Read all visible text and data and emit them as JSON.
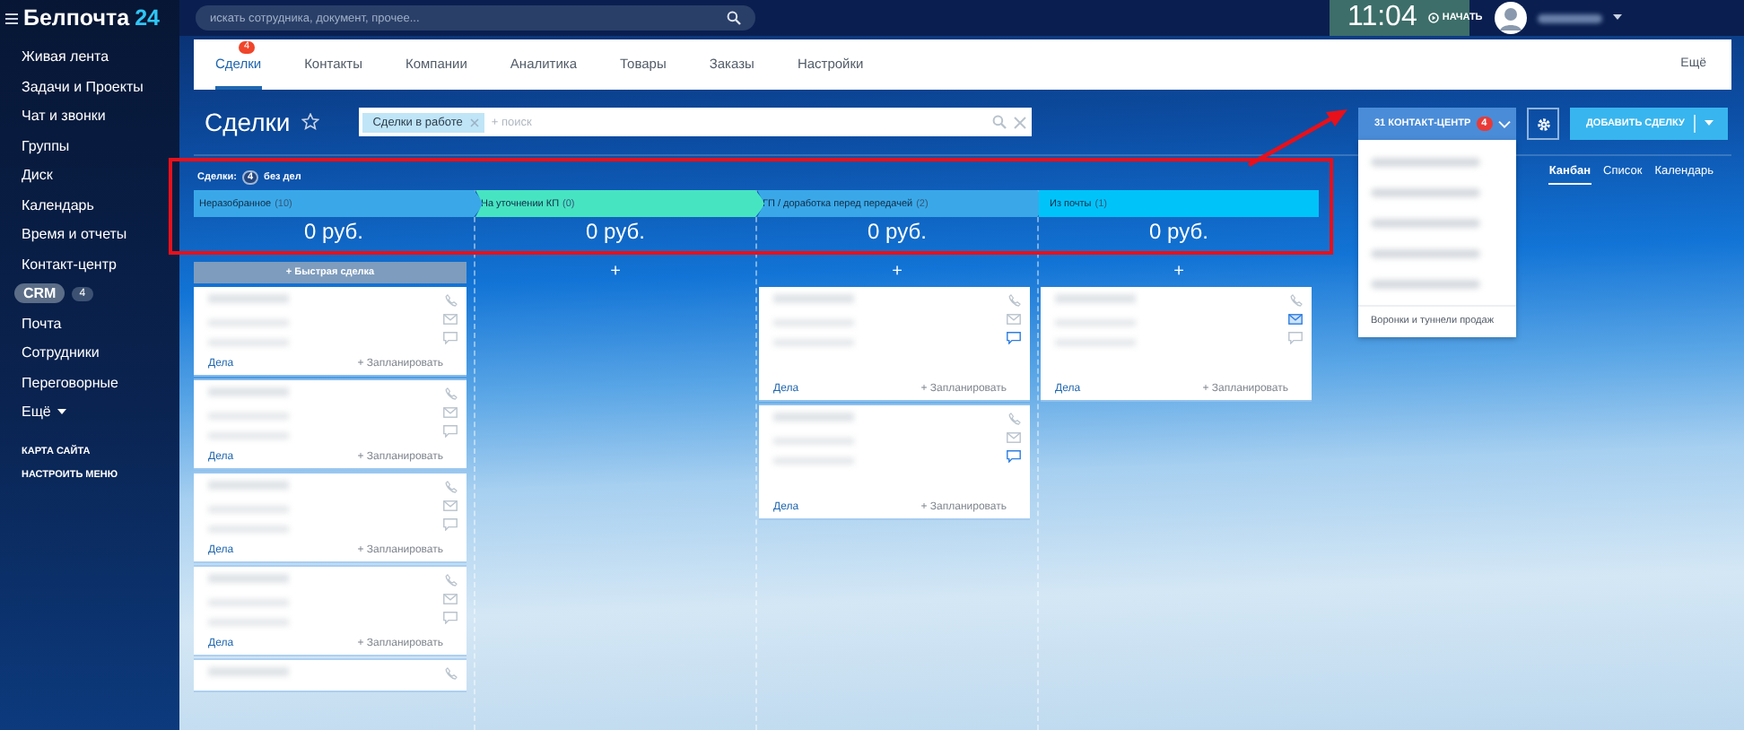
{
  "sidebar": {
    "logo": {
      "name": "Белпочта",
      "number": "24"
    },
    "items": [
      {
        "label": "Живая лента",
        "selected": false
      },
      {
        "label": "Задачи и Проекты",
        "selected": false
      },
      {
        "label": "Чат и звонки",
        "selected": false
      },
      {
        "label": "Группы",
        "selected": false
      },
      {
        "label": "Диск",
        "selected": false
      },
      {
        "label": "Календарь",
        "selected": false
      },
      {
        "label": "Время и отчеты",
        "selected": false
      },
      {
        "label": "Контакт-центр",
        "selected": false
      },
      {
        "label": "CRM",
        "selected": true,
        "badge": "4"
      },
      {
        "label": "Почта",
        "selected": false
      },
      {
        "label": "Сотрудники",
        "selected": false
      },
      {
        "label": "Переговорные",
        "selected": false
      },
      {
        "label": "Ещё",
        "selected": false,
        "caret": true
      }
    ],
    "footer_links": [
      "КАРТА САЙТА",
      "НАСТРОИТЬ МЕНЮ"
    ]
  },
  "header": {
    "search": {
      "placeholder": "искать сотрудника, документ, прочее..."
    },
    "clock": {
      "time": "11:04",
      "action": "НАЧАТЬ"
    }
  },
  "tabs": [
    {
      "label": "Сделки",
      "selected": true,
      "badge": "4"
    },
    {
      "label": "Контакты",
      "selected": false
    },
    {
      "label": "Компании",
      "selected": false
    },
    {
      "label": "Аналитика",
      "selected": false
    },
    {
      "label": "Товары",
      "selected": false
    },
    {
      "label": "Заказы",
      "selected": false
    },
    {
      "label": "Настройки",
      "selected": false
    }
  ],
  "more_tab": "Ещё",
  "page": {
    "title": "Сделки",
    "favorite": false,
    "filter": {
      "tag": "Сделки в работе",
      "placeholder": "+ поиск"
    },
    "contact_center": {
      "label": "31 КОНТАКТ-ЦЕНТР",
      "badge": "4",
      "expanded": true,
      "menu": [
        {
          "kind": "blurred"
        },
        {
          "kind": "blurred"
        },
        {
          "kind": "blurred"
        },
        {
          "kind": "blurred"
        },
        {
          "kind": "blurred"
        },
        {
          "kind": "text",
          "label": "Воронки и туннели продаж"
        }
      ]
    },
    "add_button": "ДОБАВИТЬ СДЕЛКУ",
    "views": [
      {
        "label": "Канбан",
        "selected": true
      },
      {
        "label": "Список",
        "selected": false
      },
      {
        "label": "Календарь",
        "selected": false
      }
    ]
  },
  "kanban": {
    "summary": {
      "prefix": "Сделки:",
      "count": "4",
      "suffix": "без дел"
    },
    "columns": [
      {
        "title": "Неразобранное",
        "count": "(10)",
        "color": "#3aa8e8",
        "sum": "0 руб.",
        "add": {
          "kind": "quick",
          "label": "+ Быстрая сделка"
        },
        "cards": [
          {
            "kind": "full",
            "mail_highlighted": false,
            "chat_highlighted": false,
            "tasks_link": "Дела",
            "plan_link": "+ Запланировать"
          },
          {
            "kind": "full",
            "mail_highlighted": false,
            "chat_highlighted": false,
            "tasks_link": "Дела",
            "plan_link": "+ Запланировать"
          },
          {
            "kind": "full",
            "mail_highlighted": false,
            "chat_highlighted": false,
            "tasks_link": "Дела",
            "plan_link": "+ Запланировать"
          },
          {
            "kind": "full",
            "mail_highlighted": false,
            "chat_highlighted": false,
            "tasks_link": "Дела",
            "plan_link": "+ Запланировать"
          },
          {
            "kind": "partial"
          }
        ]
      },
      {
        "title": "На уточнении КП",
        "count": "(0)",
        "color": "#47e4c2",
        "sum": "0 руб.",
        "add": {
          "kind": "plus",
          "label": "+"
        }
      },
      {
        "title": "ГП / доработка перед передачей",
        "count": "(2)",
        "color": "#3aa8e8",
        "sum": "0 руб.",
        "add": {
          "kind": "plus",
          "label": "+"
        },
        "cards": [
          {
            "kind": "full",
            "mail_highlighted": false,
            "chat_highlighted": true,
            "tasks_link": "Дела",
            "plan_link": "+ Запланировать"
          },
          {
            "kind": "full",
            "mail_highlighted": false,
            "chat_highlighted": true,
            "tasks_link": "Дела",
            "plan_link": "+ Запланировать"
          }
        ]
      },
      {
        "title": "Из почты",
        "count": "(1)",
        "color": "#00c3fa",
        "sum": "0 руб.",
        "add": {
          "kind": "plus",
          "label": "+"
        },
        "cards": [
          {
            "kind": "full",
            "mail_highlighted": true,
            "chat_highlighted": false,
            "tasks_link": "Дела",
            "plan_link": "+ Запланировать"
          }
        ]
      }
    ]
  },
  "annotations": {
    "highlight_frame": true,
    "arrow": true
  }
}
